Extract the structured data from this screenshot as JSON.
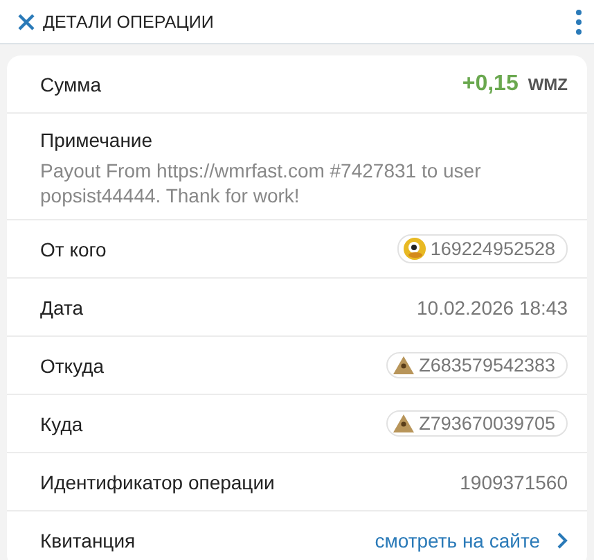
{
  "header": {
    "title": "ДЕТАЛИ ОПЕРАЦИИ"
  },
  "rows": [
    {
      "kind": "amount",
      "label": "Сумма",
      "value": "+0,15",
      "unit": "WMZ"
    },
    {
      "kind": "note",
      "label": "Примечание",
      "value": "Payout From https://wmrfast.com #7427831 to user popsist44444. Thank for work!"
    },
    {
      "kind": "user",
      "label": "От кого",
      "value": "169224952528"
    },
    {
      "kind": "text",
      "label": "Дата",
      "value": "10.02.2026 18:43"
    },
    {
      "kind": "purse",
      "label": "Откуда",
      "value": "Z683579542383"
    },
    {
      "kind": "purse",
      "label": "Куда",
      "value": "Z793670039705"
    },
    {
      "kind": "text",
      "label": "Идентификатор операции",
      "value": "1909371560"
    },
    {
      "kind": "link",
      "label": "Квитанция",
      "value": "смотреть на сайте"
    }
  ]
}
